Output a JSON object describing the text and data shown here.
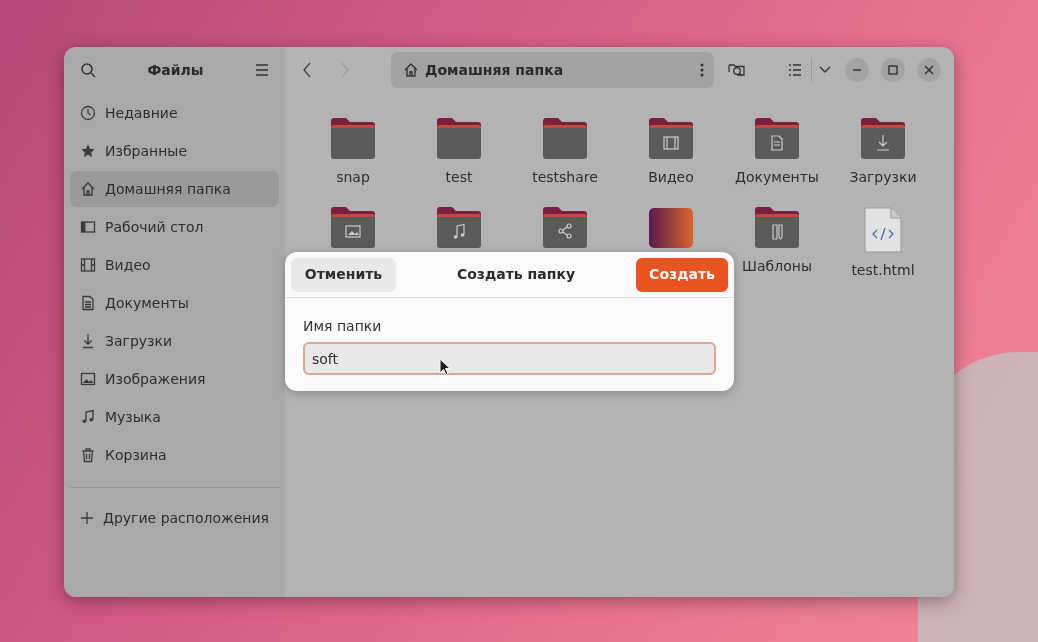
{
  "sidebar": {
    "title": "Файлы",
    "items": [
      {
        "label": "Недавние",
        "kind": "recent",
        "selected": false
      },
      {
        "label": "Избранные",
        "kind": "starred",
        "selected": false
      },
      {
        "label": "Домашняя папка",
        "kind": "home",
        "selected": true
      },
      {
        "label": "Рабочий стол",
        "kind": "desktop",
        "selected": false
      },
      {
        "label": "Видео",
        "kind": "video",
        "selected": false
      },
      {
        "label": "Документы",
        "kind": "documents",
        "selected": false
      },
      {
        "label": "Загрузки",
        "kind": "downloads",
        "selected": false
      },
      {
        "label": "Изображения",
        "kind": "pictures",
        "selected": false
      },
      {
        "label": "Музыка",
        "kind": "music",
        "selected": false
      },
      {
        "label": "Корзина",
        "kind": "trash",
        "selected": false
      }
    ],
    "other_locations": "Другие расположения"
  },
  "path_bar": {
    "label": "Домашняя папка"
  },
  "files": [
    {
      "label": "snap",
      "kind": "folder"
    },
    {
      "label": "test",
      "kind": "folder"
    },
    {
      "label": "testshare",
      "kind": "folder"
    },
    {
      "label": "Видео",
      "kind": "video-folder"
    },
    {
      "label": "Документы",
      "kind": "documents-folder"
    },
    {
      "label": "Загрузки",
      "kind": "downloads-folder"
    },
    {
      "kind": "pictures-folder"
    },
    {
      "kind": "music-folder"
    },
    {
      "kind": "shared-folder"
    },
    {
      "kind": "image-file"
    },
    {
      "label": "Шаблоны",
      "kind": "templates-folder"
    },
    {
      "label": "test.html",
      "kind": "html-file"
    }
  ],
  "dialog": {
    "cancel": "Отменить",
    "title": "Создать папку",
    "create": "Создать",
    "field_label": "Имя папки",
    "value": "soft"
  }
}
